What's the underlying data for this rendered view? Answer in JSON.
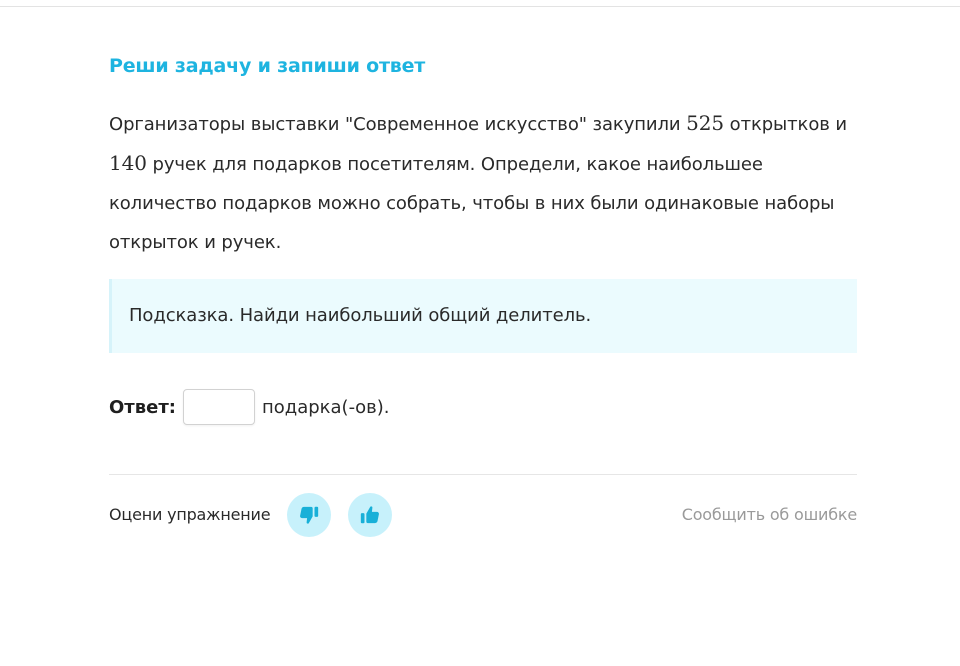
{
  "task": {
    "title": "Реши задачу и запиши ответ",
    "problem": {
      "part1": "Организаторы выставки \"Современное искусство\" закупили ",
      "num1": "525",
      "part2": " открытков и ",
      "num2": "140",
      "part3": " ручек для подарков посетителям. Определи, какое наибольшее количество подарков можно собрать, чтобы в них были одинаковые наборы открыток и ручек."
    },
    "hint": "Подсказка. Найди наибольший общий делитель."
  },
  "answer": {
    "label": "Ответ:",
    "value": "",
    "placeholder": "",
    "unit": "подарка(-ов)."
  },
  "feedback": {
    "rate_label": "Оцени упражнение",
    "dislike_icon": "thumbs-down-icon",
    "like_icon": "thumbs-up-icon",
    "report_label": "Сообщить об ошибке"
  },
  "colors": {
    "accent": "#1eb4e0",
    "hint_bg": "#ebfbfe",
    "rate_button_bg": "#c7f1fb",
    "rate_icon": "#18b0d8",
    "muted_text": "#9a9a9a"
  }
}
